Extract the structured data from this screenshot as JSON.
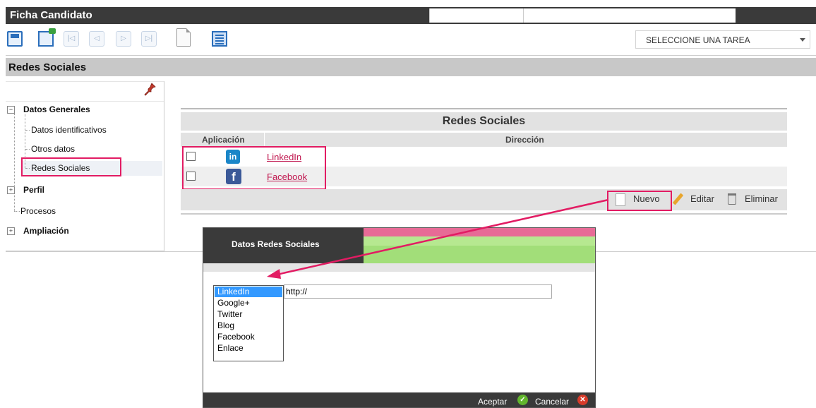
{
  "window": {
    "title": "Ficha Candidato"
  },
  "toolbar": {
    "task_select": {
      "selected": "SELECCIONE UNA TAREA"
    },
    "icons": [
      "save-icon",
      "save-exit-icon",
      "first-record-icon",
      "prev-record-icon",
      "next-record-icon",
      "last-record-icon",
      "new-document-icon",
      "list-icon"
    ]
  },
  "section": {
    "title": "Redes Sociales"
  },
  "tree": {
    "nodes": [
      {
        "label": "Datos Generales",
        "expander": "−"
      },
      {
        "label": "Datos identificativos"
      },
      {
        "label": "Otros datos"
      },
      {
        "label": "Redes Sociales",
        "selected": true
      },
      {
        "label": "Perfil",
        "expander": "+"
      },
      {
        "label": "Procesos"
      },
      {
        "label": "Ampliación",
        "expander": "+"
      }
    ]
  },
  "grid": {
    "title": "Redes Sociales",
    "columns": [
      "Aplicación",
      "Dirección"
    ],
    "rows": [
      {
        "icon": "linkedin-icon",
        "icon_text": "in",
        "link": "LinkedIn"
      },
      {
        "icon": "facebook-icon",
        "icon_text": "f",
        "link": "Facebook"
      }
    ],
    "actions": {
      "new": "Nuevo",
      "edit": "Editar",
      "delete": "Eliminar"
    }
  },
  "dialog": {
    "title": "Datos Redes Sociales",
    "options": [
      "LinkedIn",
      "Google+",
      "Twitter",
      "Blog",
      "Facebook",
      "Enlace"
    ],
    "selected_option": "LinkedIn",
    "url_value": "http://",
    "ok": "Aceptar",
    "cancel": "Cancelar"
  },
  "colors": {
    "highlight": "#e21c63",
    "header_dark": "#3a3a3a",
    "link": "#c0174f"
  }
}
